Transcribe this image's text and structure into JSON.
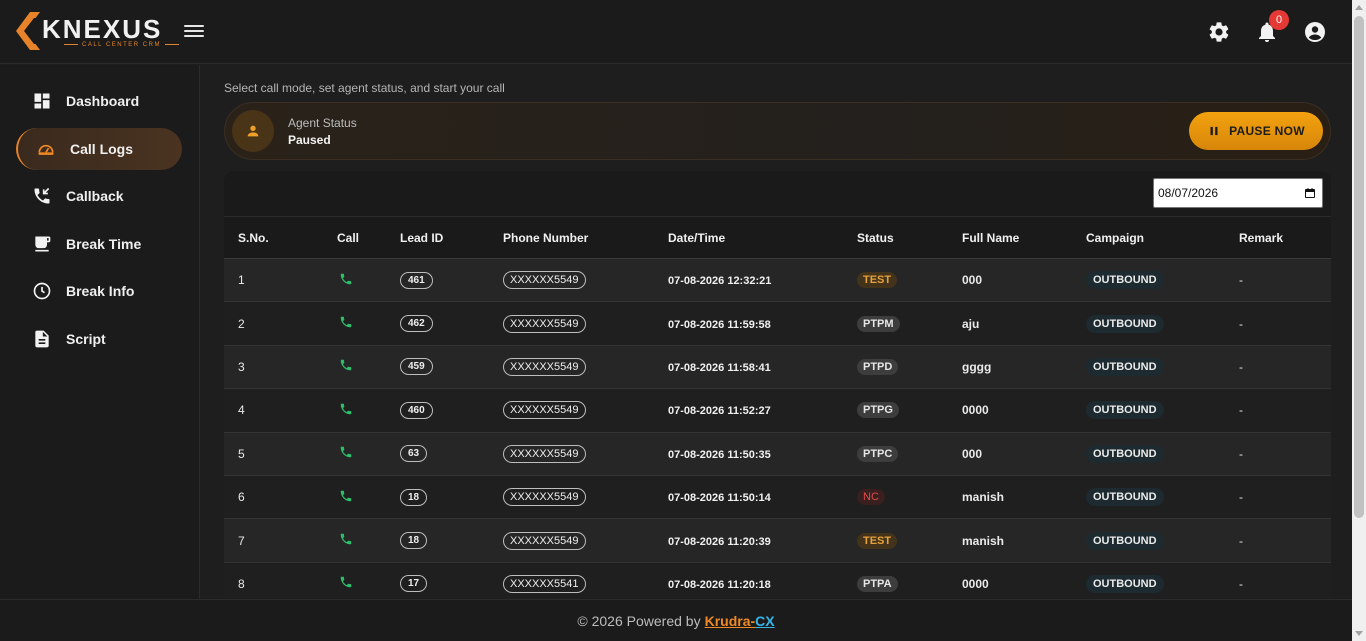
{
  "app": {
    "logo_text": "KNEXUS",
    "logo_subtitle": "CALL CENTER CRM",
    "notification_count": "0"
  },
  "sidebar": {
    "items": [
      {
        "label": "Dashboard",
        "icon": "dashboard-icon"
      },
      {
        "label": "Call Logs",
        "icon": "call-logs-icon"
      },
      {
        "label": "Callback",
        "icon": "callback-icon"
      },
      {
        "label": "Break Time",
        "icon": "coffee-icon"
      },
      {
        "label": "Break Info",
        "icon": "clock-icon"
      },
      {
        "label": "Script",
        "icon": "document-icon"
      }
    ]
  },
  "main": {
    "subtitle": "Select call mode, set agent status, and start your call",
    "agent_status_label": "Agent Status",
    "agent_status_value": "Paused",
    "pause_button": "PAUSE NOW",
    "date_value": "08/07/2026"
  },
  "table": {
    "headers": [
      "S.No.",
      "Call",
      "Lead ID",
      "Phone Number",
      "Date/Time",
      "Status",
      "Full Name",
      "Campaign",
      "Remark"
    ],
    "rows": [
      {
        "sno": "1",
        "lead": "461",
        "phone": "XXXXXX5549",
        "datetime": "07-08-2026 12:32:21",
        "status": "TEST",
        "status_kind": "test",
        "name": "000",
        "campaign": "OUTBOUND",
        "remark": "-"
      },
      {
        "sno": "2",
        "lead": "462",
        "phone": "XXXXXX5549",
        "datetime": "07-08-2026 11:59:58",
        "status": "PTPM",
        "status_kind": "gray",
        "name": "aju",
        "campaign": "OUTBOUND",
        "remark": "-"
      },
      {
        "sno": "3",
        "lead": "459",
        "phone": "XXXXXX5549",
        "datetime": "07-08-2026 11:58:41",
        "status": "PTPD",
        "status_kind": "gray",
        "name": "gggg",
        "campaign": "OUTBOUND",
        "remark": "-"
      },
      {
        "sno": "4",
        "lead": "460",
        "phone": "XXXXXX5549",
        "datetime": "07-08-2026 11:52:27",
        "status": "PTPG",
        "status_kind": "gray",
        "name": "0000",
        "campaign": "OUTBOUND",
        "remark": "-"
      },
      {
        "sno": "5",
        "lead": "63",
        "phone": "XXXXXX5549",
        "datetime": "07-08-2026 11:50:35",
        "status": "PTPC",
        "status_kind": "gray",
        "name": "000",
        "campaign": "OUTBOUND",
        "remark": "-"
      },
      {
        "sno": "6",
        "lead": "18",
        "phone": "XXXXXX5549",
        "datetime": "07-08-2026 11:50:14",
        "status": "NC",
        "status_kind": "nc",
        "name": "manish",
        "campaign": "OUTBOUND",
        "remark": "-"
      },
      {
        "sno": "7",
        "lead": "18",
        "phone": "XXXXXX5549",
        "datetime": "07-08-2026 11:20:39",
        "status": "TEST",
        "status_kind": "test",
        "name": "manish",
        "campaign": "OUTBOUND",
        "remark": "-"
      },
      {
        "sno": "8",
        "lead": "17",
        "phone": "XXXXXX5541",
        "datetime": "07-08-2026 11:20:18",
        "status": "PTPA",
        "status_kind": "gray",
        "name": "0000",
        "campaign": "OUTBOUND",
        "remark": "-"
      }
    ]
  },
  "footer": {
    "prefix": "© 2026 Powered by",
    "brand_part1": "Krudra-",
    "brand_part2": "CX"
  },
  "colors": {
    "accent": "#f08a24",
    "call_icon": "#2bbf6a",
    "badge": "#e53935"
  }
}
